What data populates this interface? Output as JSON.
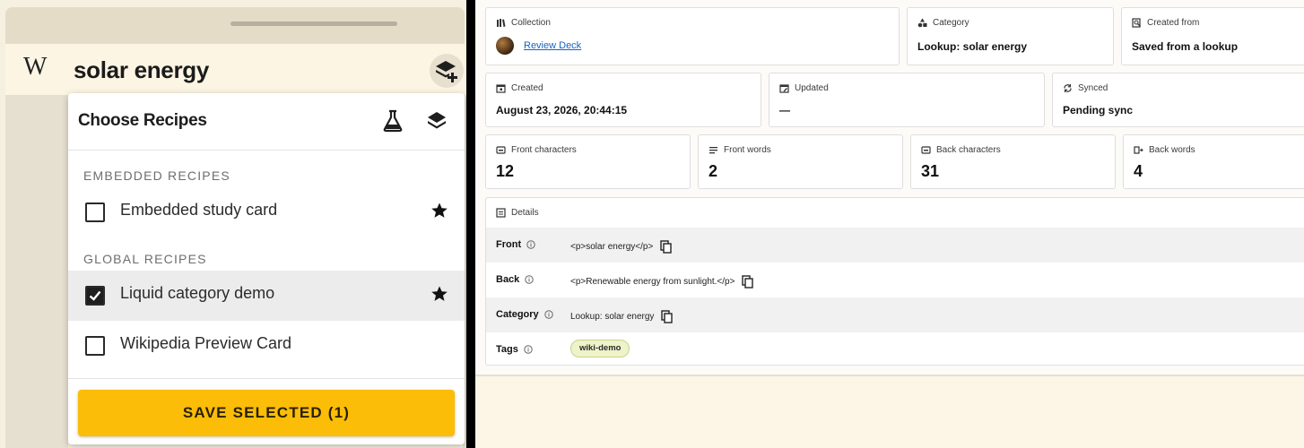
{
  "left": {
    "logo": "W",
    "search_query": "solar energy",
    "popover": {
      "title": "Choose Recipes",
      "sections": [
        {
          "label": "EMBEDDED RECIPES",
          "items": [
            {
              "label": "Embedded study card",
              "checked": false,
              "starred": true
            }
          ]
        },
        {
          "label": "GLOBAL RECIPES",
          "items": [
            {
              "label": "Liquid category demo",
              "checked": true,
              "starred": true
            },
            {
              "label": "Wikipedia Preview Card",
              "checked": false,
              "starred": false
            }
          ]
        }
      ],
      "save_label": "SAVE SELECTED (1)"
    }
  },
  "right": {
    "row1": [
      {
        "label": "Collection",
        "value": "Review Deck",
        "icon": "collection-icon"
      },
      {
        "label": "Category",
        "value": "Lookup: solar energy",
        "icon": "category-icon"
      },
      {
        "label": "Created from",
        "value": "Saved from a lookup",
        "icon": "created-from-icon"
      }
    ],
    "row2": [
      {
        "label": "Created",
        "value": "August 23, 2026, 20:44:15",
        "icon": "calendar-icon"
      },
      {
        "label": "Updated",
        "value": "—",
        "icon": "calendar-edit-icon"
      },
      {
        "label": "Synced",
        "value": "Pending sync",
        "icon": "sync-icon"
      }
    ],
    "row3": [
      {
        "label": "Front characters",
        "value": "12",
        "icon": "characters-icon"
      },
      {
        "label": "Front words",
        "value": "2",
        "icon": "words-icon"
      },
      {
        "label": "Back characters",
        "value": "31",
        "icon": "characters-icon"
      },
      {
        "label": "Back words",
        "value": "4",
        "icon": "words-icon"
      }
    ],
    "details": {
      "label": "Details",
      "rows": [
        {
          "key": "Front",
          "value": "<p>solar energy</p>"
        },
        {
          "key": "Back",
          "value": "<p>Renewable energy from sunlight.</p>"
        },
        {
          "key": "Category",
          "value": "Lookup: solar energy"
        },
        {
          "key": "Tags",
          "tag": "wiki-demo"
        }
      ]
    }
  },
  "colors": {
    "accent": "#fbbd08",
    "link": "#1565c0",
    "tag_bg": "#eef3c9"
  }
}
